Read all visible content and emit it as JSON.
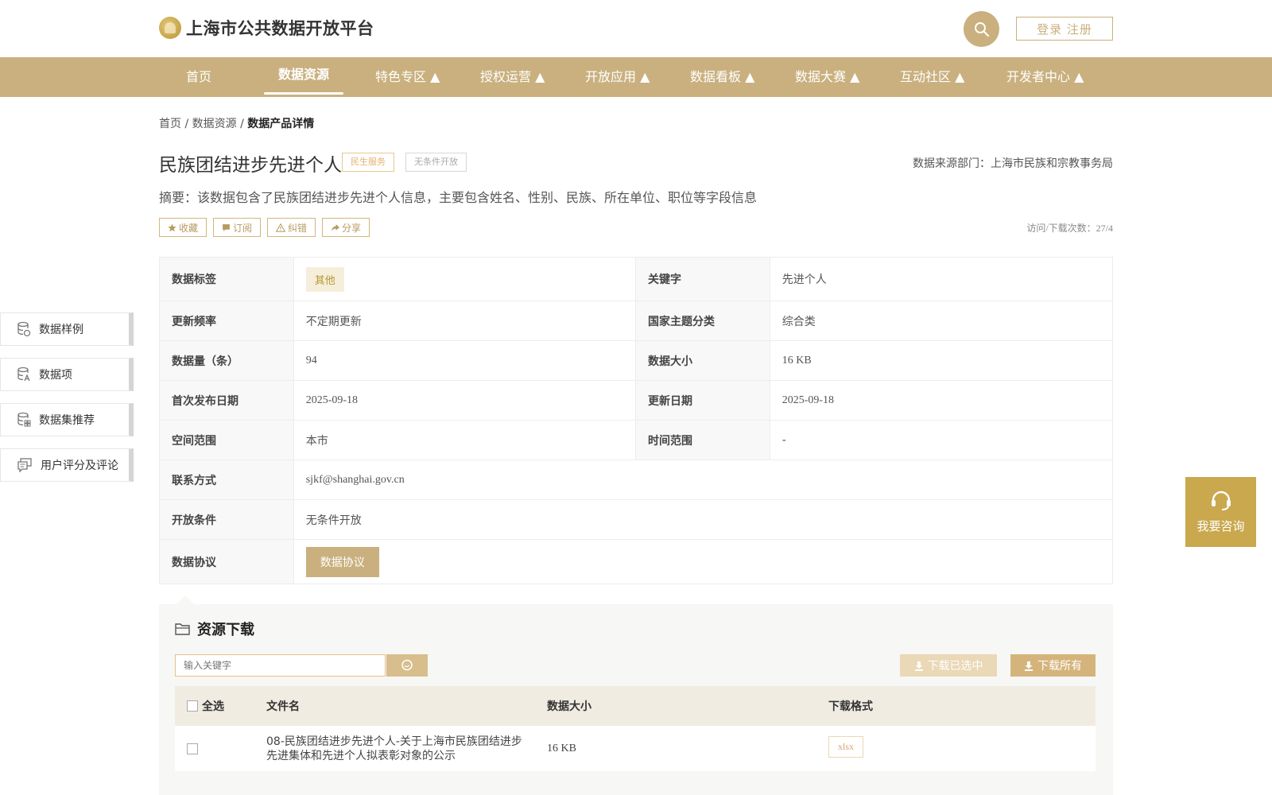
{
  "header": {
    "site_title": "上海市公共数据开放平台",
    "login_label": "登录 注册"
  },
  "nav": {
    "items": [
      {
        "label": "首页"
      },
      {
        "label": "数据资源",
        "active": true
      },
      {
        "label": "特色专区 ▲"
      },
      {
        "label": "授权运营 ▲"
      },
      {
        "label": "开放应用 ▲"
      },
      {
        "label": "数据看板 ▲"
      },
      {
        "label": "数据大赛 ▲"
      },
      {
        "label": "互动社区 ▲"
      },
      {
        "label": "开发者中心 ▲"
      }
    ]
  },
  "breadcrumb": {
    "home": "首页",
    "sep": "/",
    "section": "数据资源",
    "current": "数据产品详情"
  },
  "dataset": {
    "title": "民族团结进步先进个人",
    "tag_domain": "民生服务",
    "tag_open": "无条件开放",
    "source": "数据来源部门：上海市民族和宗教事务局",
    "summary": "摘要：该数据包含了民族团结进步先进个人信息，主要包含姓名、性别、民族、所在单位、职位等字段信息",
    "visits": "访问/下载次数：27/4"
  },
  "actions": {
    "favorite": "收藏",
    "subscribe": "订阅",
    "correct": "纠错",
    "share": "分享"
  },
  "details": {
    "tag_label": "数据标签",
    "tag_value": "其他",
    "keyword_label": "关键字",
    "keyword_value": "先进个人",
    "freq_label": "更新频率",
    "freq_value": "不定期更新",
    "theme_label": "国家主题分类",
    "theme_value": "综合类",
    "count_label": "数据量（条）",
    "count_value": "94",
    "size_label": "数据大小",
    "size_value": "16 KB",
    "first_label": "首次发布日期",
    "first_value": "2025-09-18",
    "update_label": "更新日期",
    "update_value": "2025-09-18",
    "space_label": "空间范围",
    "space_value": "本市",
    "time_label": "时间范围",
    "time_value": "-",
    "contact_label": "联系方式",
    "contact_value": "sjkf@shanghai.gov.cn",
    "cond_label": "开放条件",
    "cond_value": "无条件开放",
    "proto_label": "数据协议",
    "proto_button": "数据协议"
  },
  "side": {
    "items": [
      {
        "label": "数据样例",
        "icon": "database-icon"
      },
      {
        "label": "数据项",
        "icon": "database-search-icon"
      },
      {
        "label": "数据集推荐",
        "icon": "database-grid-icon"
      },
      {
        "label": "用户评分及评论",
        "icon": "comment-icon"
      }
    ]
  },
  "consult": {
    "label": "我要咨询"
  },
  "download": {
    "title": "资源下载",
    "search_placeholder": "输入关键字",
    "download_selected": "下载已选中",
    "download_all": "下载所有",
    "headers": {
      "select_all": "全选",
      "filename": "文件名",
      "size": "数据大小",
      "format": "下载格式"
    },
    "rows": [
      {
        "filename_line1": "08-民族团结进步先进个人-关于上海市民族团结进步",
        "filename_line2": "先进集体和先进个人拟表彰对象的公示",
        "size": "16 KB",
        "format": "xlsx"
      }
    ]
  },
  "colors": {
    "brand_gold": "#c9b07e",
    "consult_gold": "#c9a84e",
    "tag_orange": "#e7b06a"
  }
}
